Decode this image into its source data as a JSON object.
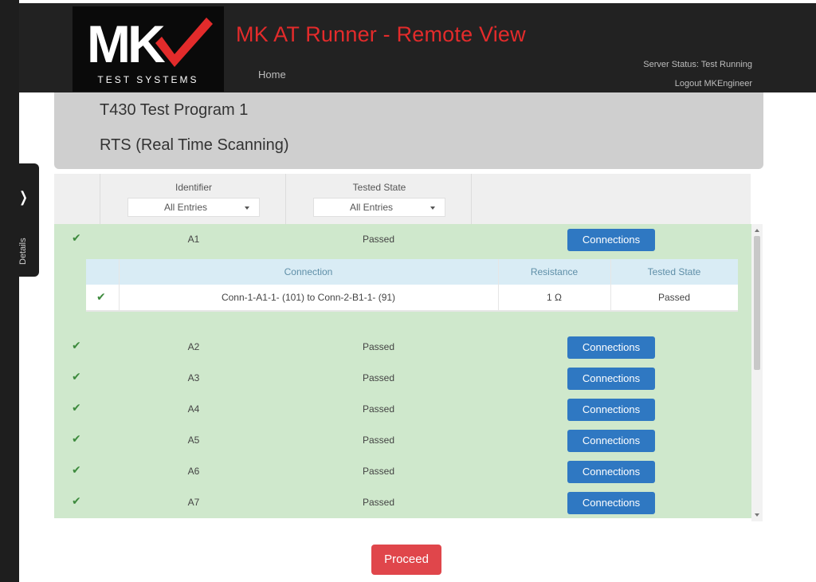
{
  "header": {
    "app_title": "MK AT Runner - Remote View",
    "logo_text": "MK",
    "logo_subtext": "TEST SYSTEMS",
    "nav_home": "Home",
    "server_status": "Server Status: Test Running",
    "logout": "Logout MKEngineer",
    "accent_color": "#e32b2b"
  },
  "side_tab": {
    "icon": "chevron-right-icon",
    "label": "Details"
  },
  "program": {
    "name": "T430 Test Program 1",
    "mode": "RTS (Real Time Scanning)"
  },
  "filters": {
    "identifier_label": "Identifier",
    "identifier_value": "All Entries",
    "tested_state_label": "Tested State",
    "tested_state_value": "All Entries"
  },
  "rows": [
    {
      "identifier": "A1",
      "state": "Passed",
      "button": "Connections"
    },
    {
      "identifier": "A2",
      "state": "Passed",
      "button": "Connections"
    },
    {
      "identifier": "A3",
      "state": "Passed",
      "button": "Connections"
    },
    {
      "identifier": "A4",
      "state": "Passed",
      "button": "Connections"
    },
    {
      "identifier": "A5",
      "state": "Passed",
      "button": "Connections"
    },
    {
      "identifier": "A6",
      "state": "Passed",
      "button": "Connections"
    },
    {
      "identifier": "A7",
      "state": "Passed",
      "button": "Connections"
    }
  ],
  "connections": {
    "headers": [
      "Connection",
      "Resistance",
      "Tested State"
    ],
    "items": [
      {
        "connection": "Conn-1-A1-1- (101) to Conn-2-B1-1- (91)",
        "resistance": "1 Ω",
        "state": "Passed"
      }
    ]
  },
  "proceed_label": "Proceed",
  "colors": {
    "passed_row": "#cfe8cc",
    "button_blue": "#2f78c2",
    "proceed_red": "#e0464b"
  }
}
